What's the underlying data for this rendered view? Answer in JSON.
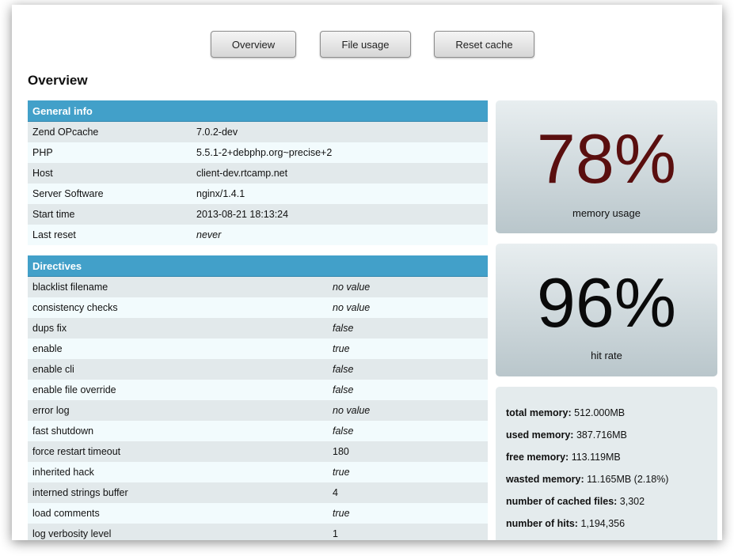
{
  "nav": {
    "overview": "Overview",
    "file_usage": "File usage",
    "reset_cache": "Reset cache"
  },
  "page_title": "Overview",
  "general_info": {
    "header": "General info",
    "rows": [
      {
        "k": "Zend OPcache",
        "v": "7.0.2-dev"
      },
      {
        "k": "PHP",
        "v": "5.5.1-2+debphp.org~precise+2"
      },
      {
        "k": "Host",
        "v": "client-dev.rtcamp.net"
      },
      {
        "k": "Server Software",
        "v": "nginx/1.4.1"
      },
      {
        "k": "Start time",
        "v": "2013-08-21 18:13:24"
      },
      {
        "k": "Last reset",
        "v": "never"
      }
    ]
  },
  "directives": {
    "header": "Directives",
    "rows": [
      {
        "k": "blacklist filename",
        "v": "no value"
      },
      {
        "k": "consistency checks",
        "v": "no value"
      },
      {
        "k": "dups fix",
        "v": "false"
      },
      {
        "k": "enable",
        "v": "true"
      },
      {
        "k": "enable cli",
        "v": "false"
      },
      {
        "k": "enable file override",
        "v": "false"
      },
      {
        "k": "error log",
        "v": "no value"
      },
      {
        "k": "fast shutdown",
        "v": "false"
      },
      {
        "k": "force restart timeout",
        "v": "180"
      },
      {
        "k": "inherited hack",
        "v": "true"
      },
      {
        "k": "interned strings buffer",
        "v": "4"
      },
      {
        "k": "load comments",
        "v": "true"
      },
      {
        "k": "log verbosity level",
        "v": "1"
      }
    ]
  },
  "memory_usage": {
    "value": "78%",
    "label": "memory usage",
    "color": "#5a0f0f"
  },
  "hit_rate": {
    "value": "96%",
    "label": "hit rate",
    "color": "#0a0a0a"
  },
  "stats": [
    {
      "label": "total memory:",
      "value": "512.000MB"
    },
    {
      "label": "used memory:",
      "value": "387.716MB"
    },
    {
      "label": "free memory:",
      "value": "113.119MB"
    },
    {
      "label": "wasted memory:",
      "value": "11.165MB (2.18%)"
    },
    {
      "label": "number of cached files:",
      "value": "3,302"
    },
    {
      "label": "number of hits:",
      "value": "1,194,356"
    }
  ]
}
